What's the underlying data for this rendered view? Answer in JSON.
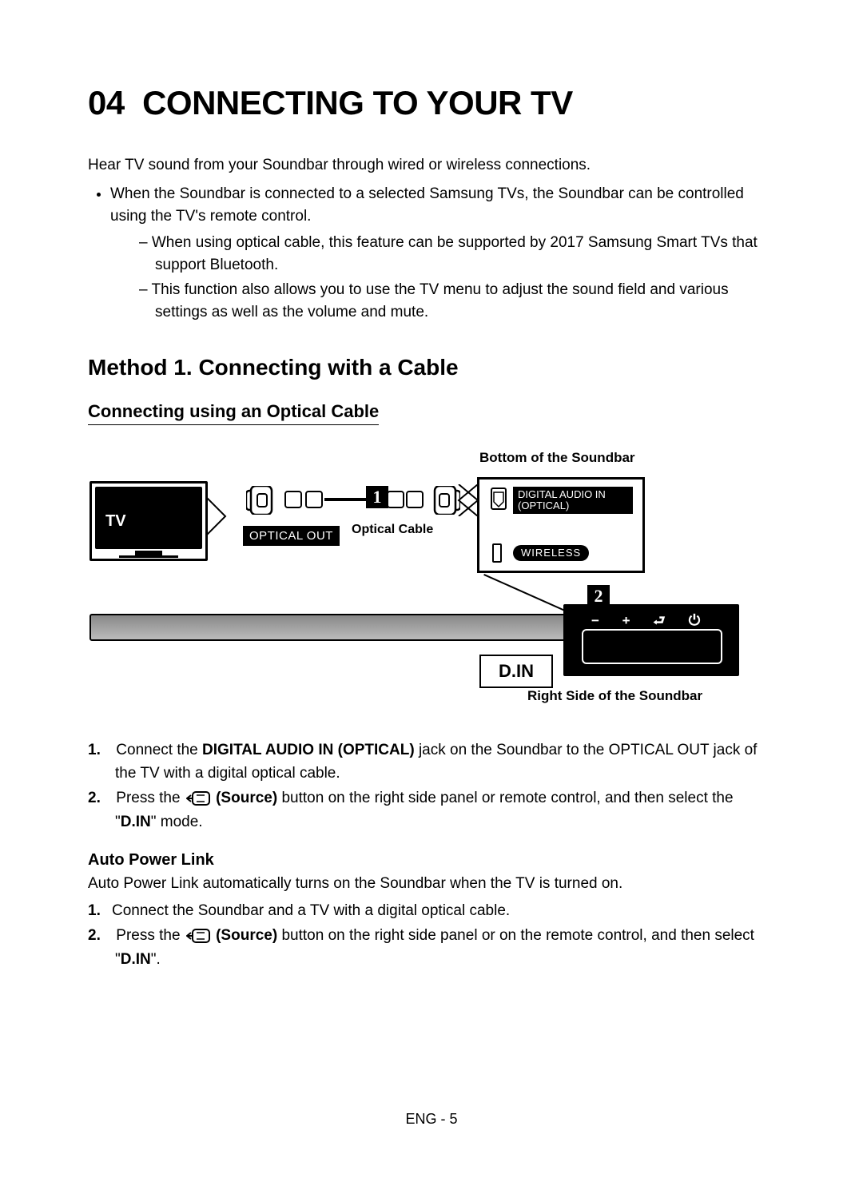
{
  "chapter": {
    "num": "04",
    "title": "CONNECTING TO YOUR TV"
  },
  "intro": "Hear TV sound from your Soundbar through wired or wireless connections.",
  "bullet1": "When the Soundbar is connected to a selected Samsung TVs, the Soundbar can be controlled using the TV's remote control.",
  "dash1": "When using optical cable, this feature can be supported by 2017 Samsung Smart TVs that support Bluetooth.",
  "dash2": "This function also allows you to use the TV menu to adjust the sound field and various settings as well as the volume and mute.",
  "method1_title": "Method 1. Connecting with a Cable",
  "optical_section_title": "Connecting using an Optical Cable",
  "diagram": {
    "top_caption": "Bottom of the Soundbar",
    "tv_label": "TV",
    "optical_out": "OPTICAL OUT",
    "optical_cable": "Optical Cable",
    "digital_audio_in": "DIGITAL AUDIO IN (OPTICAL)",
    "wireless": "WIRELESS",
    "din": "D.IN",
    "callout1": "1",
    "callout2": "2",
    "right_caption": "Right Side of the Soundbar",
    "rp_icons": "−  +  ⮐  ⏻"
  },
  "step1_pre": "Connect the ",
  "step1_b": "DIGITAL AUDIO IN (OPTICAL)",
  "step1_post": " jack on the Soundbar to the OPTICAL OUT jack of the TV with a digital optical cable.",
  "step2_pre": "Press the ",
  "step2_source": " (Source)",
  "step2_mid": " button on the right side panel or remote control, and then select the \"",
  "step2_din": "D.IN",
  "step2_end": "\" mode.",
  "apl_title": "Auto Power Link",
  "apl_desc": "Auto Power Link automatically turns on the Soundbar when the TV is turned on.",
  "apl_step1": "Connect the Soundbar and a TV with a digital optical cable.",
  "apl_step2_pre": "Press the ",
  "apl_step2_source": " (Source)",
  "apl_step2_mid": " button on the right side panel or on the remote control, and then select \"",
  "apl_step2_din": "D.IN",
  "apl_step2_end": "\".",
  "page_num": "ENG - 5"
}
